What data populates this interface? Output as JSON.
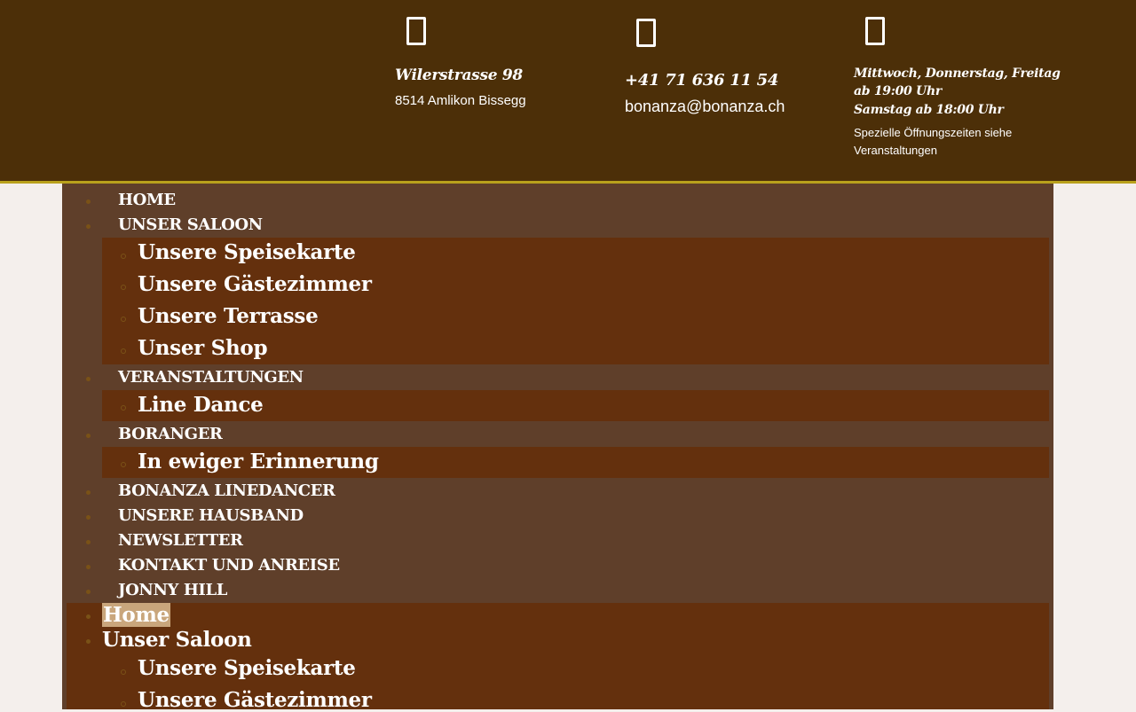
{
  "header": {
    "address": {
      "icon": "map-marker-icon",
      "street": "Wilerstrasse 98",
      "city": "8514 Amlikon Bissegg"
    },
    "contact": {
      "icon": "phone-icon",
      "phone": "+41 71 636 11 54",
      "email": "bonanza@bonanza.ch"
    },
    "hours": {
      "icon": "clock-icon",
      "line1": "Mittwoch, Donnerstag, Freitag",
      "line2": "ab 19:00 Uhr",
      "line3": "Samstag ab 18:00 Uhr",
      "note1": "Spezielle Öffnungszeiten siehe",
      "note2": "Veranstaltungen"
    },
    "colors": {
      "background": "#4c2f08",
      "accent_border": "#b9a11c"
    }
  },
  "nav": {
    "items": [
      {
        "label": "HOME"
      },
      {
        "label": "UNSER SALOON"
      },
      {
        "label": "VERANSTALTUNGEN"
      },
      {
        "label": "BORANGER"
      },
      {
        "label": "BONANZA LINEDANCER"
      },
      {
        "label": "UNSERE HAUSBAND"
      },
      {
        "label": "NEWSLETTER"
      },
      {
        "label": "KONTAKT UND ANREISE"
      },
      {
        "label": "JONNY HILL"
      }
    ],
    "saloon_sub": [
      {
        "label": "Unsere Speisekarte"
      },
      {
        "label": "Unsere Gästezimmer"
      },
      {
        "label": "Unsere Terrasse"
      },
      {
        "label": "Unser Shop"
      }
    ],
    "veranstaltungen_sub": [
      {
        "label": "Line Dance"
      }
    ],
    "boranger_sub": [
      {
        "label": "In ewiger Erinnerung"
      }
    ]
  },
  "mobile_nav": {
    "items": [
      {
        "label": "Home"
      },
      {
        "label": "Unser Saloon"
      }
    ],
    "saloon_sub": [
      {
        "label": "Unsere Speisekarte"
      },
      {
        "label": "Unsere Gästezimmer"
      }
    ]
  },
  "colors": {
    "page_background": "#f4efec",
    "nav_background": "#5f3f2a",
    "submenu_background": "#64300d",
    "bullet": "#7a5217",
    "highlight": "#c9a67c"
  }
}
